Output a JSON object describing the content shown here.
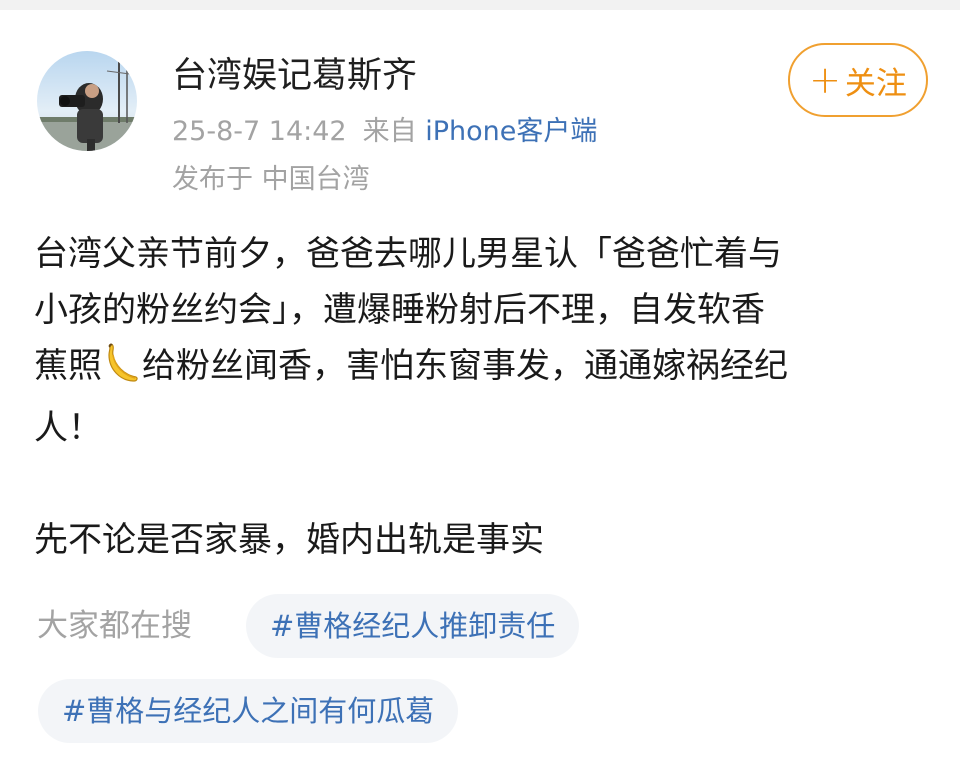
{
  "author": {
    "name": "台湾娱记葛斯齐",
    "avatar_icon": "avatar-photographer",
    "timestamp": "25-8-7 14:42",
    "source_prefix": "来自",
    "source": "iPhone客户端",
    "location": "发布于 中国台湾"
  },
  "follow_button": {
    "label": "关注",
    "icon": "plus-icon",
    "color": "#ee8f12"
  },
  "post": {
    "paragraph1": {
      "line1": "台湾父亲节前夕，爸爸去哪儿男星认「爸爸忙着与",
      "line2": "小孩的粉丝约会」，遭爆睡粉射后不理，自发软香",
      "line3_before": "蕉照",
      "line3_emoji": "banana-emoji",
      "line3_after": "给粉丝闻香，害怕东窗事发，通通嫁祸经纪",
      "line4": "人！"
    },
    "paragraph2": "先不论是否家暴，婚内出轨是事实"
  },
  "trending": {
    "label": "大家都在搜",
    "topics": [
      "#曹格经纪人推卸责任",
      "#曹格与经纪人之间有何瓜葛"
    ]
  },
  "colors": {
    "link_blue": "#3d71b6",
    "muted_gray": "#a3a3a3",
    "chip_bg": "#f3f5f8"
  }
}
